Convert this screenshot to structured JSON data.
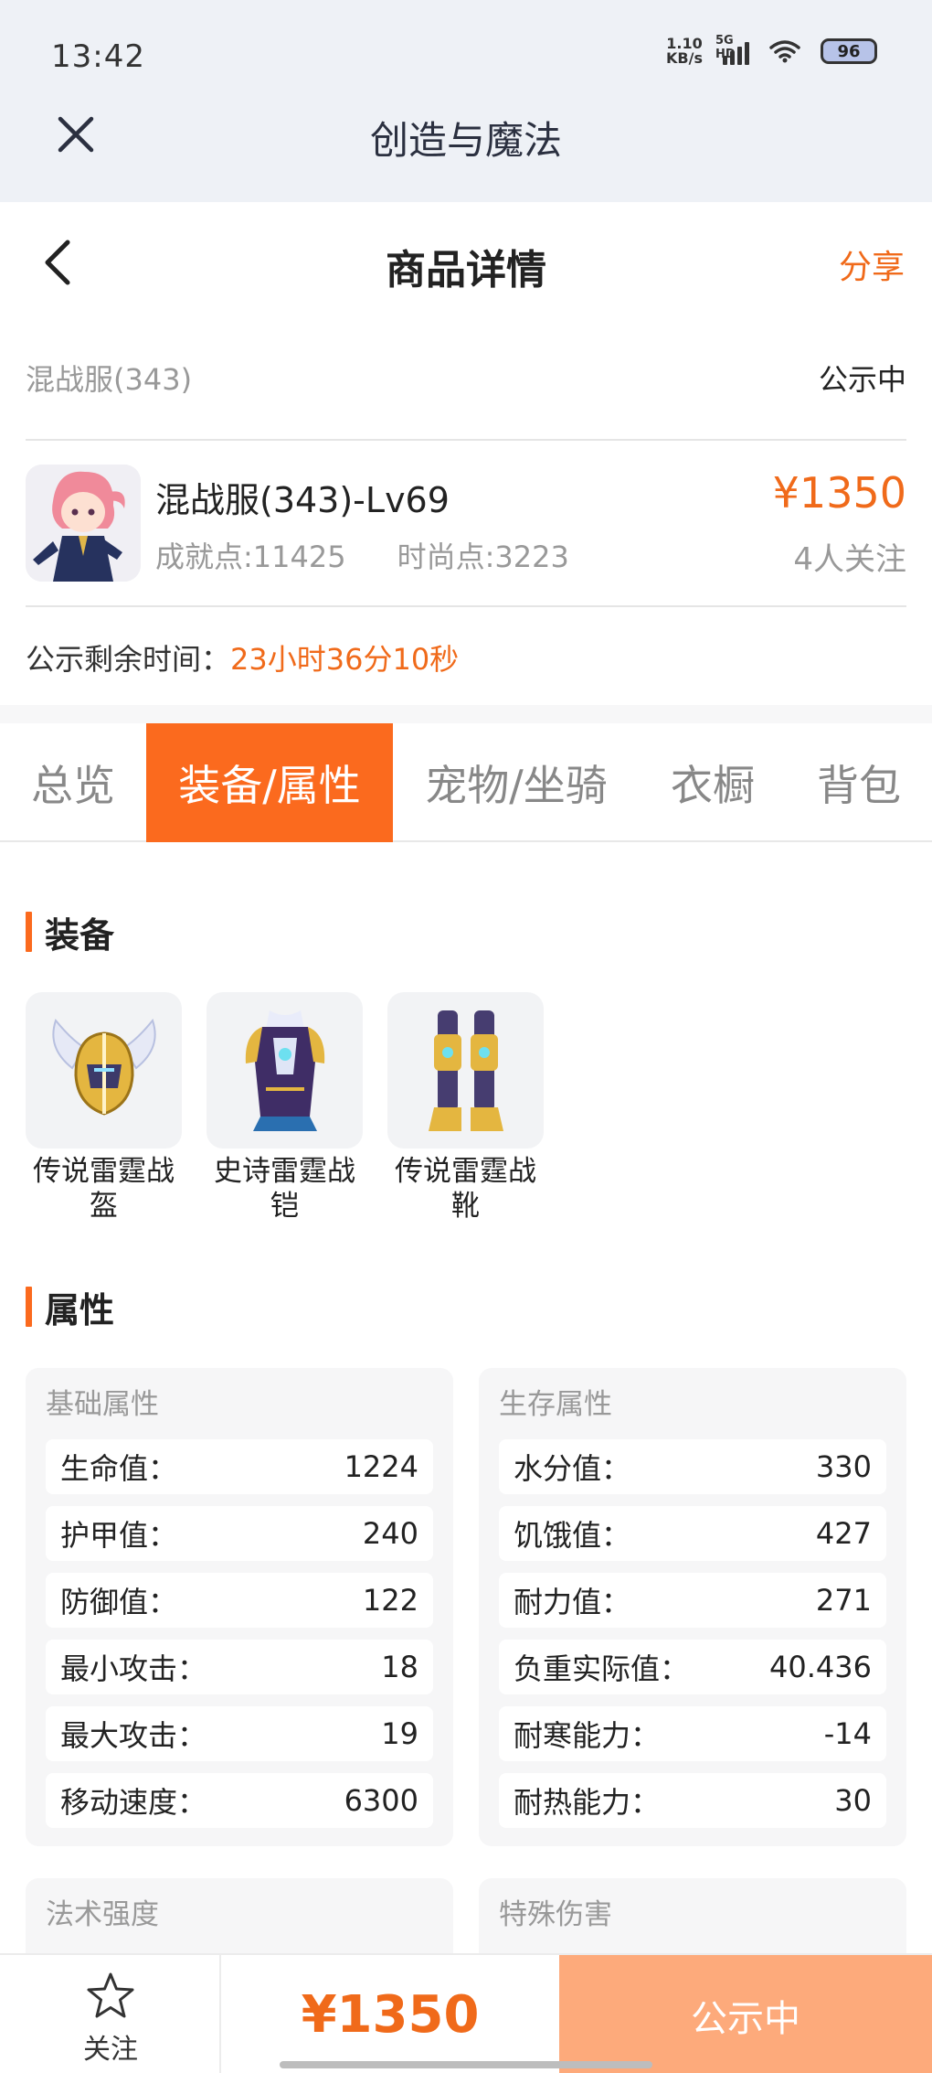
{
  "status_bar": {
    "time": "13:42",
    "net_speed_value": "1.10",
    "net_speed_unit": "KB/s",
    "network_tag": "5G HD",
    "battery": "96"
  },
  "app_bar": {
    "title": "创造与魔法"
  },
  "nav": {
    "title": "商品详情",
    "share": "分享"
  },
  "summary": {
    "server": "混战服(343)",
    "status": "公示中",
    "item_name": "混战服(343)-Lv69",
    "achievement": "成就点:11425",
    "fashion": "时尚点:3223",
    "price": "¥1350",
    "watchers": "4人关注",
    "timer_label": "公示剩余时间：",
    "timer_value": "23小时36分10秒"
  },
  "tabs": [
    {
      "label": "总览",
      "active": false
    },
    {
      "label": "装备/属性",
      "active": true
    },
    {
      "label": "宠物/坐骑",
      "active": false
    },
    {
      "label": "衣橱",
      "active": false
    },
    {
      "label": "背包",
      "active": false
    }
  ],
  "equipment": {
    "title": "装备",
    "items": [
      {
        "name_line1": "传说雷霆战",
        "name_line2": "盔",
        "icon": "helmet-icon"
      },
      {
        "name_line1": "史诗雷霆战",
        "name_line2": "铠",
        "icon": "armor-icon"
      },
      {
        "name_line1": "传说雷霆战",
        "name_line2": "靴",
        "icon": "boots-icon"
      }
    ]
  },
  "attributes": {
    "title": "属性",
    "basic": {
      "title": "基础属性",
      "rows": [
        {
          "label": "生命值：",
          "value": "1224"
        },
        {
          "label": "护甲值：",
          "value": "240"
        },
        {
          "label": "防御值：",
          "value": "122"
        },
        {
          "label": "最小攻击：",
          "value": "18"
        },
        {
          "label": "最大攻击：",
          "value": "19"
        },
        {
          "label": "移动速度：",
          "value": "6300"
        }
      ]
    },
    "survival": {
      "title": "生存属性",
      "rows": [
        {
          "label": "水分值：",
          "value": "330"
        },
        {
          "label": "饥饿值：",
          "value": "427"
        },
        {
          "label": "耐力值：",
          "value": "271"
        },
        {
          "label": "负重实际值：",
          "value": "40.436"
        },
        {
          "label": "耐寒能力：",
          "value": "-14"
        },
        {
          "label": "耐热能力：",
          "value": "30"
        }
      ]
    },
    "magic": {
      "title": "法术强度"
    },
    "special": {
      "title": "特殊伤害"
    }
  },
  "bottom_bar": {
    "follow_label": "关注",
    "price": "¥1350",
    "action_label": "公示中"
  },
  "colors": {
    "accent": "#fb6a1e",
    "price": "#f06a1a",
    "action_button": "#fdaa7b",
    "header_bg": "#eef1f6"
  }
}
